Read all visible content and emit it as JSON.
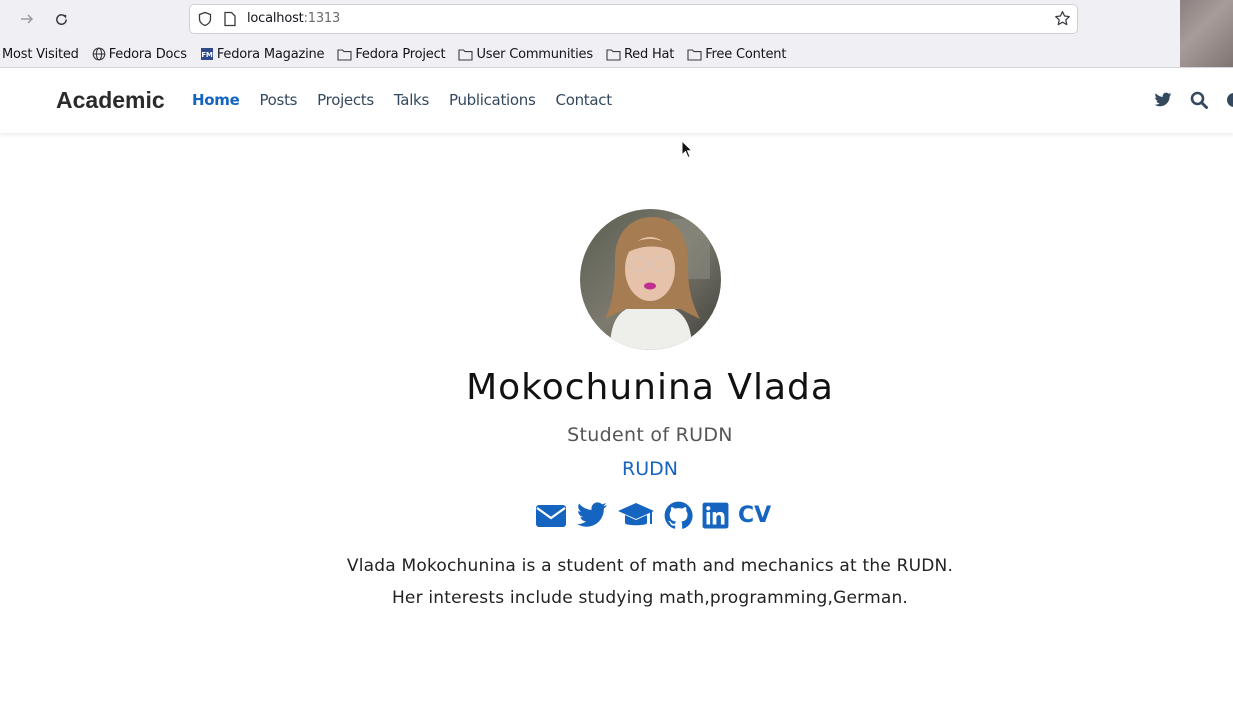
{
  "browser": {
    "url_host": "localhost",
    "url_port": ":1313",
    "bookmarks": [
      {
        "label": "Most Visited",
        "icon": "none"
      },
      {
        "label": "Fedora Docs",
        "icon": "globe-icon"
      },
      {
        "label": "Fedora Magazine",
        "icon": "fm-icon"
      },
      {
        "label": "Fedora Project",
        "icon": "folder-icon"
      },
      {
        "label": "User Communities",
        "icon": "folder-icon"
      },
      {
        "label": "Red Hat",
        "icon": "folder-icon"
      },
      {
        "label": "Free Content",
        "icon": "folder-icon"
      }
    ]
  },
  "site": {
    "brand": "Academic",
    "menu": [
      "Home",
      "Posts",
      "Projects",
      "Talks",
      "Publications",
      "Contact"
    ],
    "active_menu": "Home"
  },
  "profile": {
    "name": "Mokochunina Vlada",
    "role": "Student of RUDN",
    "organization": "RUDN",
    "social": [
      "envelope-icon",
      "twitter-icon",
      "graduation-cap-icon",
      "github-icon",
      "linkedin-icon",
      "cv-icon"
    ],
    "cv_label": "CV",
    "bio_line1": "Vlada Mokochunina is a student of math and mechanics at the RUDN.",
    "bio_line2": "Her interests include studying math,programming,German."
  },
  "colors": {
    "accent": "#1565c0",
    "chrome_bg": "#f0f0f4"
  }
}
